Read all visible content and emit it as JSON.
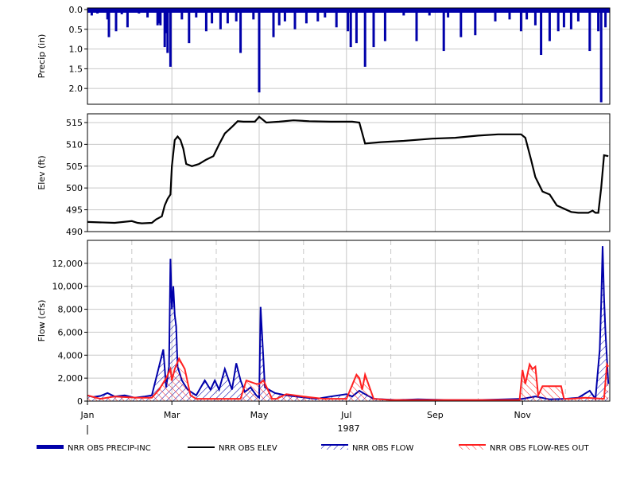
{
  "chart_data": [
    {
      "type": "bar",
      "ylabel": "Precip (in)",
      "inverted": true,
      "ylim": [
        0,
        2.4
      ],
      "yticks": [
        "0.0",
        "0.5",
        "1.0",
        "1.5",
        "2.0"
      ],
      "ytick_values": [
        0,
        0.5,
        1,
        1.5,
        2
      ],
      "grid": true,
      "series": [
        {
          "name": "NRR OBS PRECIP-INC",
          "color": "#0000aa",
          "x": [
            "1987-01-04",
            "1987-01-08",
            "1987-01-15",
            "1987-01-16",
            "1987-01-21",
            "1987-01-25",
            "1987-01-29",
            "1987-02-06",
            "1987-02-12",
            "1987-02-19",
            "1987-02-20",
            "1987-02-21",
            "1987-02-24",
            "1987-02-25",
            "1987-02-26",
            "1987-02-28",
            "1987-03-08",
            "1987-03-13",
            "1987-03-18",
            "1987-03-25",
            "1987-03-29",
            "1987-04-04",
            "1987-04-09",
            "1987-04-15",
            "1987-04-18",
            "1987-04-27",
            "1987-05-01",
            "1987-05-11",
            "1987-05-15",
            "1987-05-19",
            "1987-05-26",
            "1987-06-03",
            "1987-06-11",
            "1987-06-16",
            "1987-06-24",
            "1987-07-02",
            "1987-07-04",
            "1987-07-08",
            "1987-07-14",
            "1987-07-20",
            "1987-07-28",
            "1987-08-10",
            "1987-08-19",
            "1987-08-28",
            "1987-09-07",
            "1987-09-10",
            "1987-09-19",
            "1987-09-29",
            "1987-10-13",
            "1987-10-23",
            "1987-10-31",
            "1987-11-04",
            "1987-11-10",
            "1987-11-14",
            "1987-11-20",
            "1987-11-26",
            "1987-11-30",
            "1987-12-05",
            "1987-12-10",
            "1987-12-18",
            "1987-12-24",
            "1987-12-26",
            "1987-12-29"
          ],
          "values": [
            0.15,
            0.1,
            0.25,
            0.7,
            0.55,
            0.12,
            0.45,
            0.1,
            0.2,
            0.4,
            0.35,
            0.4,
            0.95,
            0.6,
            1.1,
            1.45,
            0.25,
            0.85,
            0.2,
            0.55,
            0.35,
            0.5,
            0.35,
            0.3,
            1.1,
            0.25,
            2.1,
            0.7,
            0.4,
            0.3,
            0.5,
            0.35,
            0.3,
            0.2,
            0.45,
            0.55,
            0.95,
            0.85,
            1.45,
            0.95,
            0.8,
            0.15,
            0.8,
            0.15,
            1.05,
            0.2,
            0.7,
            0.65,
            0.3,
            0.25,
            0.55,
            0.25,
            0.4,
            1.15,
            0.8,
            0.55,
            0.45,
            0.5,
            0.3,
            1.05,
            0.55,
            2.35,
            0.45
          ]
        }
      ]
    },
    {
      "type": "line",
      "ylabel": "Elev (ft)",
      "ylim": [
        490,
        517
      ],
      "yticks": [
        "515",
        "510",
        "505",
        "500",
        "495",
        "490"
      ],
      "ytick_values": [
        515,
        510,
        505,
        500,
        495,
        490
      ],
      "grid": true,
      "series": [
        {
          "name": "NRR OBS ELEV",
          "color": "#000000",
          "x": [
            "1987-01-01",
            "1987-01-20",
            "1987-02-01",
            "1987-02-05",
            "1987-02-08",
            "1987-02-15",
            "1987-02-18",
            "1987-02-22",
            "1987-02-24",
            "1987-02-26",
            "1987-02-28",
            "1987-03-01",
            "1987-03-03",
            "1987-03-05",
            "1987-03-07",
            "1987-03-09",
            "1987-03-11",
            "1987-03-15",
            "1987-03-20",
            "1987-03-25",
            "1987-03-30",
            "1987-04-03",
            "1987-04-07",
            "1987-04-12",
            "1987-04-16",
            "1987-04-20",
            "1987-04-28",
            "1987-05-01",
            "1987-05-03",
            "1987-05-06",
            "1987-05-15",
            "1987-05-25",
            "1987-06-05",
            "1987-06-20",
            "1987-07-05",
            "1987-07-10",
            "1987-07-14",
            "1987-07-25",
            "1987-08-10",
            "1987-08-30",
            "1987-09-15",
            "1987-10-01",
            "1987-10-15",
            "1987-10-31",
            "1987-11-03",
            "1987-11-07",
            "1987-11-10",
            "1987-11-15",
            "1987-11-20",
            "1987-11-25",
            "1987-12-05",
            "1987-12-10",
            "1987-12-17",
            "1987-12-20",
            "1987-12-22",
            "1987-12-24",
            "1987-12-26",
            "1987-12-28",
            "1987-12-31"
          ],
          "values": [
            492.2,
            492.0,
            492.4,
            492.0,
            491.9,
            492.0,
            492.8,
            493.5,
            496.0,
            497.5,
            498.5,
            505.0,
            511.0,
            511.8,
            511.0,
            509.0,
            505.5,
            505.0,
            505.5,
            506.5,
            507.3,
            510.0,
            512.5,
            514.0,
            515.3,
            515.2,
            515.2,
            516.3,
            515.8,
            515.0,
            515.2,
            515.5,
            515.3,
            515.2,
            515.2,
            515.0,
            510.2,
            510.5,
            510.8,
            511.3,
            511.5,
            512.0,
            512.3,
            512.3,
            511.5,
            506.5,
            502.5,
            499.2,
            498.5,
            496.0,
            494.5,
            494.3,
            494.3,
            494.8,
            494.3,
            494.3,
            500.0,
            507.5,
            507.3
          ]
        }
      ]
    },
    {
      "type": "area",
      "ylabel": "Flow (cfs)",
      "ylim": [
        0,
        14000
      ],
      "yticks": [
        "12,000",
        "10,000",
        "8,000",
        "6,000",
        "4,000",
        "2,000",
        "0"
      ],
      "ytick_values": [
        12000,
        10000,
        8000,
        6000,
        4000,
        2000,
        0
      ],
      "grid": true,
      "x_categories": [
        "Jan",
        "Mar",
        "May",
        "Jul",
        "Sep",
        "Nov"
      ],
      "x_ticks": [
        "1987-01-01",
        "1987-03-01",
        "1987-05-01",
        "1987-07-01",
        "1987-09-01",
        "1987-11-01"
      ],
      "x_year_label": "1987",
      "series": [
        {
          "name": "NRR OBS FLOW",
          "color": "#0000aa",
          "x": [
            "1987-01-01",
            "1987-01-05",
            "1987-01-10",
            "1987-01-15",
            "1987-01-20",
            "1987-01-27",
            "1987-02-03",
            "1987-02-10",
            "1987-02-15",
            "1987-02-20",
            "1987-02-23",
            "1987-02-25",
            "1987-02-27",
            "1987-02-28",
            "1987-03-01",
            "1987-03-02",
            "1987-03-03",
            "1987-03-04",
            "1987-03-05",
            "1987-03-08",
            "1987-03-12",
            "1987-03-18",
            "1987-03-24",
            "1987-03-28",
            "1987-03-31",
            "1987-04-03",
            "1987-04-07",
            "1987-04-12",
            "1987-04-15",
            "1987-04-18",
            "1987-04-21",
            "1987-04-25",
            "1987-04-29",
            "1987-05-01",
            "1987-05-02",
            "1987-05-05",
            "1987-05-12",
            "1987-05-20",
            "1987-05-30",
            "1987-06-10",
            "1987-06-20",
            "1987-07-01",
            "1987-07-05",
            "1987-07-10",
            "1987-07-14",
            "1987-07-20",
            "1987-08-05",
            "1987-08-20",
            "1987-09-10",
            "1987-10-01",
            "1987-10-20",
            "1987-11-01",
            "1987-11-10",
            "1987-11-20",
            "1987-12-01",
            "1987-12-10",
            "1987-12-18",
            "1987-12-22",
            "1987-12-25",
            "1987-12-26",
            "1987-12-27",
            "1987-12-28",
            "1987-12-29",
            "1987-12-31"
          ],
          "values": [
            500,
            350,
            450,
            700,
            400,
            500,
            300,
            400,
            500,
            3000,
            4500,
            1200,
            3000,
            12400,
            8000,
            10000,
            7500,
            6500,
            3000,
            1800,
            1000,
            500,
            1800,
            1000,
            1800,
            1000,
            2800,
            1000,
            3300,
            1800,
            800,
            1200,
            500,
            300,
            8200,
            1200,
            700,
            500,
            350,
            200,
            400,
            600,
            400,
            900,
            600,
            200,
            100,
            150,
            100,
            100,
            150,
            200,
            400,
            150,
            200,
            300,
            900,
            200,
            4500,
            8500,
            13500,
            9000,
            6000,
            1500
          ]
        },
        {
          "name": "NRR OBS FLOW-RES OUT",
          "color": "#ff2020",
          "x": [
            "1987-01-01",
            "1987-01-10",
            "1987-01-20",
            "1987-02-05",
            "1987-02-15",
            "1987-02-20",
            "1987-02-25",
            "1987-02-28",
            "1987-03-01",
            "1987-03-03",
            "1987-03-06",
            "1987-03-10",
            "1987-03-14",
            "1987-03-18",
            "1987-03-25",
            "1987-04-10",
            "1987-04-18",
            "1987-04-22",
            "1987-04-29",
            "1987-05-01",
            "1987-05-04",
            "1987-05-10",
            "1987-05-13",
            "1987-05-20",
            "1987-06-01",
            "1987-06-15",
            "1987-07-01",
            "1987-07-08",
            "1987-07-10",
            "1987-07-12",
            "1987-07-14",
            "1987-07-20",
            "1987-08-01",
            "1987-09-01",
            "1987-10-01",
            "1987-10-30",
            "1987-11-01",
            "1987-11-03",
            "1987-11-06",
            "1987-11-08",
            "1987-11-10",
            "1987-11-12",
            "1987-11-15",
            "1987-11-20",
            "1987-11-28",
            "1987-11-30",
            "1987-12-05",
            "1987-12-15",
            "1987-12-28",
            "1987-12-30",
            "1987-12-31"
          ],
          "values": [
            500,
            200,
            400,
            300,
            300,
            1000,
            2000,
            2800,
            1800,
            2800,
            3700,
            2800,
            500,
            200,
            200,
            200,
            200,
            1800,
            1500,
            1500,
            1800,
            200,
            200,
            600,
            400,
            200,
            200,
            2300,
            2000,
            1000,
            2300,
            200,
            100,
            100,
            100,
            100,
            2700,
            1500,
            3200,
            2800,
            3000,
            500,
            1300,
            1300,
            1300,
            200,
            200,
            300,
            200,
            3200,
            3000
          ]
        }
      ]
    }
  ],
  "legend": [
    {
      "label": "NRR OBS PRECIP-INC",
      "kind": "thick-bar",
      "color": "#0000aa"
    },
    {
      "label": "NRR OBS ELEV",
      "kind": "line",
      "color": "#000000"
    },
    {
      "label": "NRR OBS FLOW",
      "kind": "hatch-area",
      "color": "#0000aa"
    },
    {
      "label": "NRR OBS FLOW-RES OUT",
      "kind": "hatch-area",
      "color": "#ff2020"
    }
  ]
}
